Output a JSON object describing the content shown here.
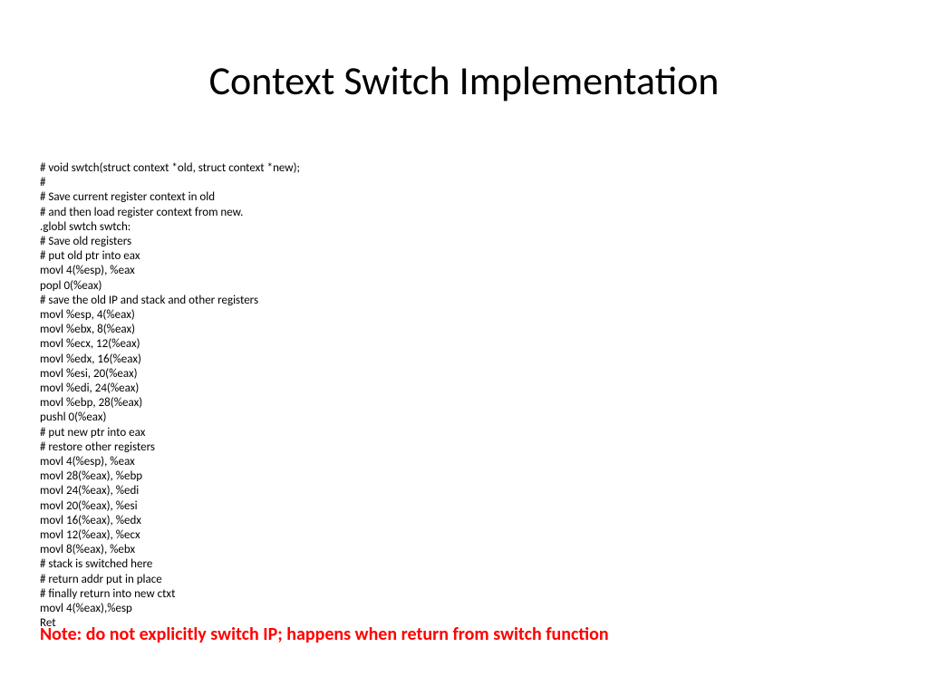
{
  "slide": {
    "title": "Context Switch Implementation",
    "code_lines": [
      "# void swtch(struct context *old, struct context *new);",
      "#",
      "# Save current register context in old",
      "# and then load register context from new.",
      ".globl swtch swtch:",
      "# Save old registers",
      "# put old ptr into eax",
      "movl 4(%esp), %eax",
      "popl 0(%eax)",
      "# save the old IP and stack and other registers",
      "movl %esp, 4(%eax)",
      "movl %ebx, 8(%eax)",
      "movl %ecx, 12(%eax)",
      "movl %edx, 16(%eax)",
      "movl %esi, 20(%eax)",
      "movl %edi, 24(%eax)",
      "movl %ebp, 28(%eax)",
      "pushl 0(%eax)",
      "# put new ptr into eax",
      "# restore other registers",
      "movl 4(%esp), %eax",
      "movl 28(%eax), %ebp",
      "movl 24(%eax), %edi",
      "movl 20(%eax), %esi",
      "movl 16(%eax), %edx",
      "movl 12(%eax), %ecx",
      "movl 8(%eax), %ebx",
      "# stack is switched here",
      "# return addr put in place",
      "# finally return into new ctxt",
      "movl 4(%eax),%esp",
      "Ret"
    ],
    "note": "Note: do not explicitly switch IP; happens when return from switch function"
  }
}
